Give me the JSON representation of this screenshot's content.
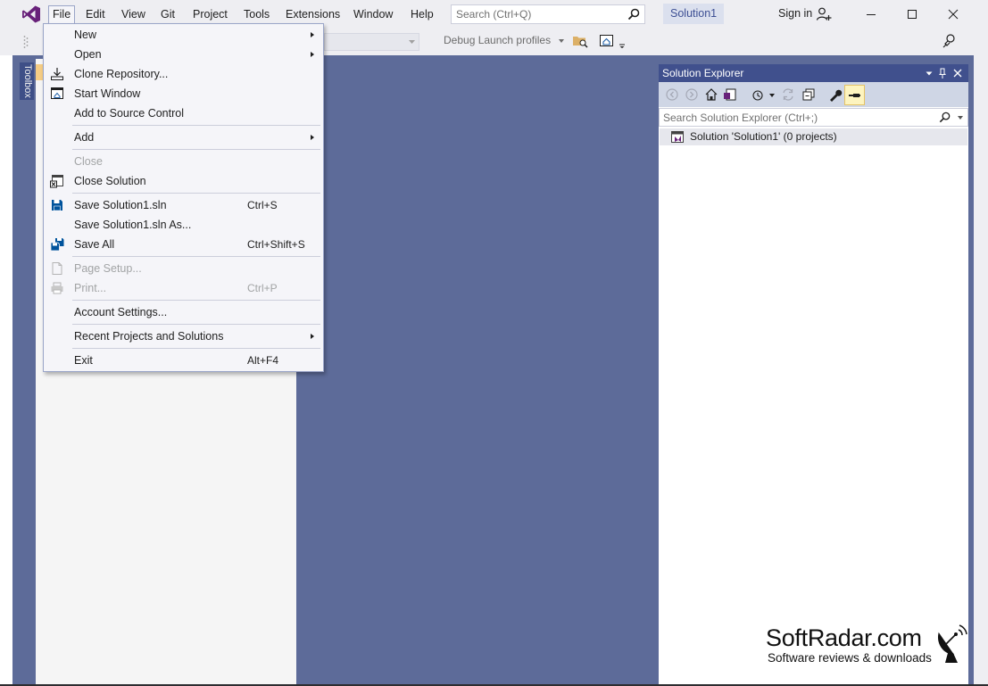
{
  "menubar": {
    "items": [
      {
        "label": "File"
      },
      {
        "label": "Edit"
      },
      {
        "label": "View"
      },
      {
        "label": "Git"
      },
      {
        "label": "Project"
      },
      {
        "label": "Tools"
      },
      {
        "label": "Extensions"
      },
      {
        "label": "Window"
      },
      {
        "label": "Help"
      }
    ],
    "search_placeholder": "Search (Ctrl+Q)",
    "solution_name": "Solution1",
    "sign_in": "Sign in"
  },
  "toolbar": {
    "debug_launch_profiles": "Debug Launch profiles"
  },
  "toolbox": {
    "tab_label": "Toolbox"
  },
  "file_menu": {
    "items": [
      {
        "label": "New",
        "shortcut": "",
        "submenu": true,
        "disabled": false,
        "icon": ""
      },
      {
        "label": "Open",
        "shortcut": "",
        "submenu": true,
        "disabled": false,
        "icon": ""
      },
      {
        "label": "Clone Repository...",
        "shortcut": "",
        "submenu": false,
        "disabled": false,
        "icon": "clone-icon"
      },
      {
        "label": "Start Window",
        "shortcut": "",
        "submenu": false,
        "disabled": false,
        "icon": "start-window-icon"
      },
      {
        "label": "Add to Source Control",
        "shortcut": "",
        "submenu": false,
        "disabled": false,
        "icon": ""
      },
      {
        "label": "Add",
        "shortcut": "",
        "submenu": true,
        "disabled": false,
        "icon": ""
      },
      {
        "label": "Close",
        "shortcut": "",
        "submenu": false,
        "disabled": true,
        "icon": ""
      },
      {
        "label": "Close Solution",
        "shortcut": "",
        "submenu": false,
        "disabled": false,
        "icon": "close-solution-icon"
      },
      {
        "label": "Save Solution1.sln",
        "shortcut": "Ctrl+S",
        "submenu": false,
        "disabled": false,
        "icon": "save-icon"
      },
      {
        "label": "Save Solution1.sln As...",
        "shortcut": "",
        "submenu": false,
        "disabled": false,
        "icon": ""
      },
      {
        "label": "Save All",
        "shortcut": "Ctrl+Shift+S",
        "submenu": false,
        "disabled": false,
        "icon": "save-all-icon"
      },
      {
        "label": "Page Setup...",
        "shortcut": "",
        "submenu": false,
        "disabled": true,
        "icon": "page-setup-icon"
      },
      {
        "label": "Print...",
        "shortcut": "Ctrl+P",
        "submenu": false,
        "disabled": true,
        "icon": "print-icon"
      },
      {
        "label": "Account Settings...",
        "shortcut": "",
        "submenu": false,
        "disabled": false,
        "icon": ""
      },
      {
        "label": "Recent Projects and Solutions",
        "shortcut": "",
        "submenu": true,
        "disabled": false,
        "icon": ""
      },
      {
        "label": "Exit",
        "shortcut": "Alt+F4",
        "submenu": false,
        "disabled": false,
        "icon": ""
      }
    ]
  },
  "solution_explorer": {
    "title": "Solution Explorer",
    "search_placeholder": "Search Solution Explorer (Ctrl+;)",
    "root_item": "Solution 'Solution1' (0 projects)"
  },
  "watermark": {
    "title": "SoftRadar.com",
    "subtitle": "Software reviews & downloads"
  },
  "colors": {
    "accent": "#68217a",
    "workspace": "#5d6b99",
    "panel_header": "#40508d",
    "chrome": "#eeeef2"
  }
}
